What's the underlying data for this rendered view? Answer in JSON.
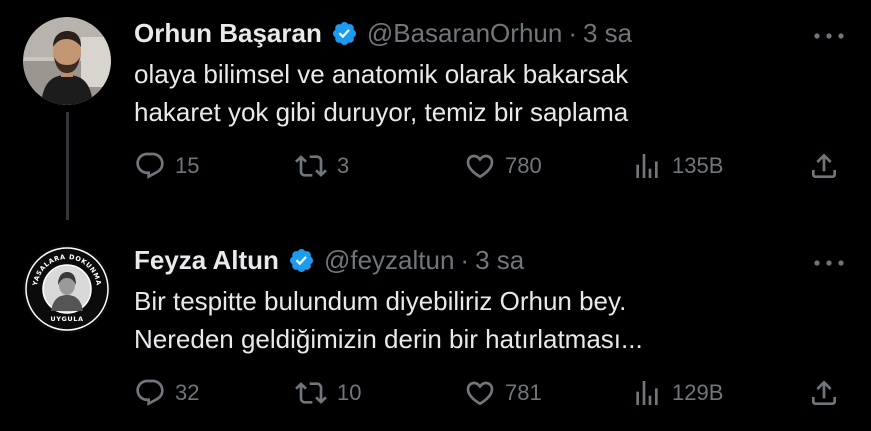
{
  "tweets": [
    {
      "author": {
        "name": "Orhun Başaran",
        "handle": "@BasaranOrhun",
        "verified": true
      },
      "separator": "·",
      "time": "3 sa",
      "text_lines": [
        "olaya bilimsel ve anatomik olarak bakarsak",
        "hakaret yok gibi duruyor, temiz bir saplama"
      ],
      "stats": {
        "replies": "15",
        "retweets": "3",
        "likes": "780",
        "views": "135B"
      }
    },
    {
      "author": {
        "name": "Feyza Altun",
        "handle": "@feyzaltun",
        "verified": true,
        "avatar_ring_text_top": "YASALARA DOKUNMA",
        "avatar_ring_text_bottom": "UYGULA"
      },
      "separator": "·",
      "time": "3 sa",
      "text_lines": [
        "Bir tespitte bulundum diyebiliriz Orhun bey.",
        "Nereden geldiğimizin derin bir hatırlatması..."
      ],
      "stats": {
        "replies": "32",
        "retweets": "10",
        "likes": "781",
        "views": "129B"
      }
    }
  ],
  "colors": {
    "background": "#000000",
    "primary_text": "#e7e9ea",
    "secondary_text": "#71767b",
    "verified_badge": "#1d9bf0",
    "thread_line": "#333639"
  },
  "icons": [
    "reply-icon",
    "retweet-icon",
    "like-icon",
    "views-icon",
    "share-icon",
    "more-icon",
    "verified-badge-icon"
  ]
}
